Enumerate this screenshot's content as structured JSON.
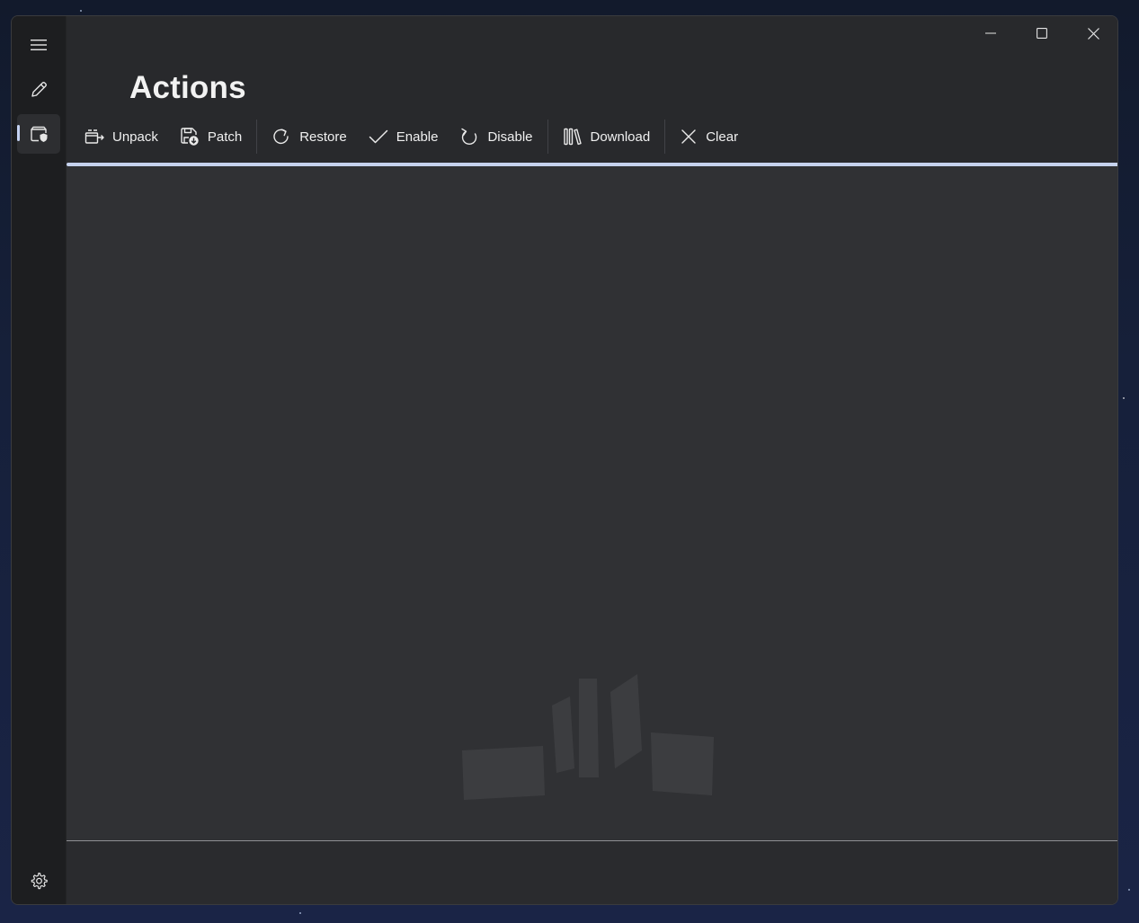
{
  "window": {
    "caption_buttons": [
      {
        "name": "minimize-button",
        "icon": "minimize-icon"
      },
      {
        "name": "maximize-button",
        "icon": "maximize-icon"
      },
      {
        "name": "close-button",
        "icon": "close-icon"
      }
    ]
  },
  "nav": {
    "items": [
      {
        "name": "nav-menu-toggle",
        "icon": "hamburger-icon",
        "selected": false
      },
      {
        "name": "nav-item-edit",
        "icon": "pencil-icon",
        "selected": false
      },
      {
        "name": "nav-item-actions",
        "icon": "package-shield-icon",
        "selected": true
      }
    ],
    "footer_items": [
      {
        "name": "nav-item-settings",
        "icon": "gear-icon"
      }
    ]
  },
  "page": {
    "title": "Actions"
  },
  "toolbar": {
    "unpack": "Unpack",
    "patch": "Patch",
    "restore": "Restore",
    "enable": "Enable",
    "disable": "Disable",
    "download": "Download",
    "clear": "Clear"
  },
  "progress": {
    "value_percent": 100
  },
  "colors": {
    "accent": "#c6d2ee",
    "window_bg": "#242526",
    "content_bg": "#303134",
    "text": "#f0f0f0"
  }
}
